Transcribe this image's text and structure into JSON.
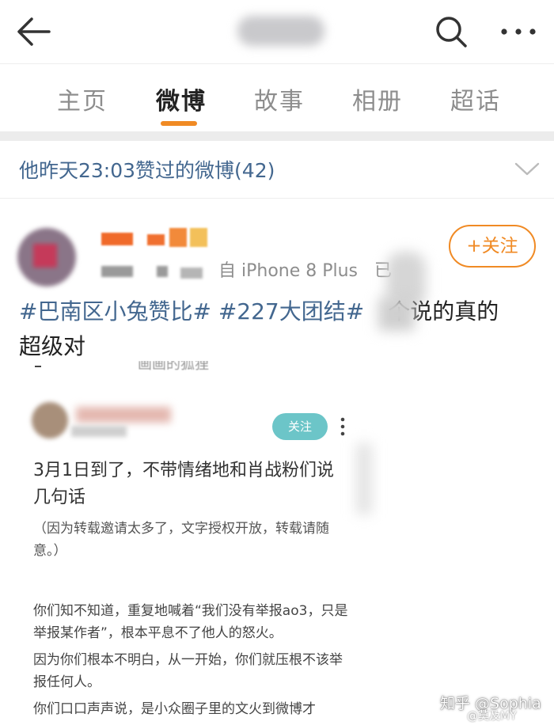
{
  "header": {
    "title": "",
    "back_icon": "arrow-left-icon",
    "search_icon": "search-icon",
    "more_icon": "more-dots-icon"
  },
  "tabs": [
    {
      "label": "主页",
      "active": false
    },
    {
      "label": "微博",
      "active": true
    },
    {
      "label": "故事",
      "active": false
    },
    {
      "label": "相册",
      "active": false
    },
    {
      "label": "超话",
      "active": false
    }
  ],
  "accent_color": "#f08a24",
  "link_color": "#43678f",
  "liked_section": {
    "label": "他昨天23:03赞过的微博(42)",
    "chevron_icon": "chevron-down-icon"
  },
  "post": {
    "source": "自 iPhone 8 Plus",
    "source_suffix": "已",
    "follow_button": "+关注",
    "hashtag1": "#巴南区小兔赞比#",
    "hashtag2": "#227大团结#",
    "text_rest": "个说的真的",
    "text_line2": "超级对"
  },
  "embedded": {
    "cut_text": "画画的狐狸",
    "follow_button": "关注",
    "title": "3月1日到了，不带情绪地和肖战粉们说几句话",
    "note": "（因为转载邀请太多了，文字授权开放，转载请随意。）",
    "para1": "你们知不知道，重复地喊着“我们没有举报ao3，只是举报某作者”，根本平息不了他人的怒火。",
    "para2": "因为你们根本不明白，从一开始，你们就压根不该举报任何人。",
    "para3": "你们口口声声说，是小众圈子里的文火到微博才"
  },
  "watermark": {
    "text": "知乎 @Sophia",
    "sub": "@莫及MY"
  }
}
